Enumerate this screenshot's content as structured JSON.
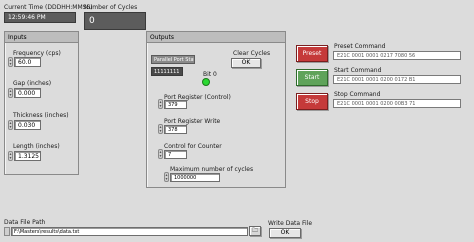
{
  "current_time": {
    "label": "Current Time (DDDHH:MMSS)",
    "value": "12:59:46 PM"
  },
  "cycles": {
    "label": "Number of Cycles",
    "value": "0"
  },
  "inputs": {
    "title": "Inputs",
    "frequency": {
      "label": "Frequency (cps)",
      "value": "60.0"
    },
    "gap": {
      "label": "Gap (inches)",
      "value": "0.000"
    },
    "thickness": {
      "label": "Thickness (inches)",
      "value": "0.030"
    },
    "length": {
      "label": "Length (inches)",
      "value": "1.3125"
    }
  },
  "outputs": {
    "title": "Outputs",
    "parallel_port": {
      "label": "Parallel Port Status Pins",
      "value": "11111111"
    },
    "bit": {
      "label": "Bit 0"
    },
    "clear_cycles": {
      "label": "Clear Cycles",
      "button": "OK"
    },
    "port_register_control": {
      "label": "Port Register (Control)",
      "value": "379"
    },
    "port_register_write": {
      "label": "Port Register Write",
      "value": "378"
    },
    "control_counter": {
      "label": "Control for Counter",
      "value": "7"
    },
    "max_cycles": {
      "label": "Maximum number of cycles",
      "value": "1000000"
    }
  },
  "commands": {
    "preset": {
      "button": "Preset",
      "label": "Preset Command",
      "value": "E21C 0001 0001 0217 7080 56"
    },
    "start": {
      "button": "Start",
      "label": "Start Command",
      "value": "E21C 0001 0001 0200 0172 B1"
    },
    "stop": {
      "button": "Stop",
      "label": "Stop Command",
      "value": "E21C 0001 0001 0200 00B3 71"
    }
  },
  "data_file": {
    "label": "Data File Path",
    "value": "F:\\Masters\\results\\data.txt"
  },
  "write_data": {
    "label": "Write Data File",
    "button": "OK"
  },
  "colors": {
    "indicator": "#5c5c5c",
    "led": "#2bd832",
    "preset": "#c53a3a",
    "start": "#5fa35a",
    "stop": "#c53a3a"
  }
}
